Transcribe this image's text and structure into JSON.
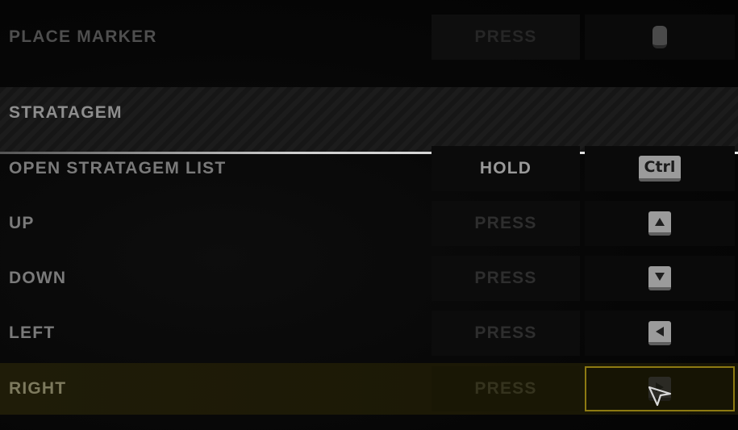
{
  "top_row": {
    "label": "PLACE MARKER",
    "action": "PRESS"
  },
  "section": {
    "title": "STRATAGEM"
  },
  "rows": [
    {
      "label": "OPEN STRATAGEM LIST",
      "action": "HOLD",
      "key": "Ctrl",
      "key_icon": "ctrl-key-icon"
    },
    {
      "label": "UP",
      "action": "PRESS",
      "key_icon": "arrow-up-key-icon"
    },
    {
      "label": "DOWN",
      "action": "PRESS",
      "key_icon": "arrow-down-key-icon"
    },
    {
      "label": "LEFT",
      "action": "PRESS",
      "key_icon": "arrow-left-key-icon"
    },
    {
      "label": "RIGHT",
      "action": "PRESS",
      "key_icon": "arrow-right-key-icon"
    }
  ],
  "colors": {
    "highlight_border": "#8d7a12",
    "divider": "#e8e8e8"
  }
}
